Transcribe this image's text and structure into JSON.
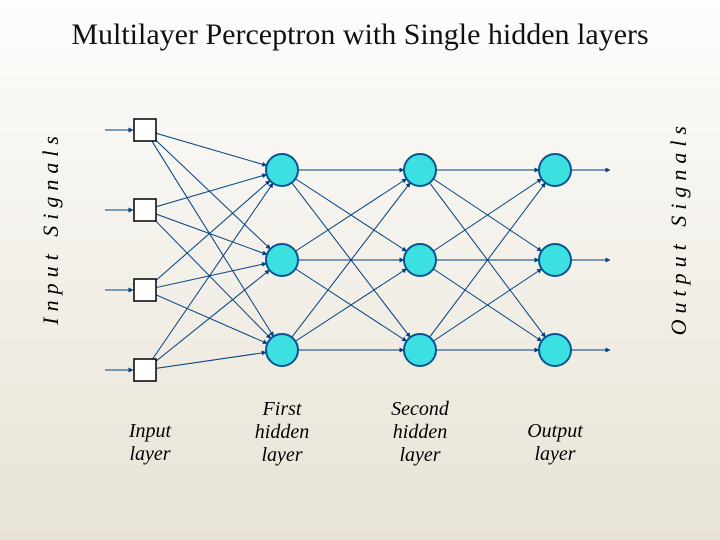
{
  "title": "Multilayer Perceptron with Single hidden layers",
  "side_labels": {
    "input": "Input Signals",
    "output": "Output Signals"
  },
  "layers": {
    "input": {
      "label_line1": "Input",
      "label_line2": "layer"
    },
    "hidden1": {
      "label_line1": "First",
      "label_line2": "hidden",
      "label_line3": "layer"
    },
    "hidden2": {
      "label_line1": "Second",
      "label_line2": "hidden",
      "label_line3": "layer"
    },
    "output": {
      "label_line1": "Output",
      "label_line2": "layer"
    }
  },
  "network": {
    "input_nodes": 4,
    "hidden1_nodes": 3,
    "hidden2_nodes": 3,
    "output_nodes": 3,
    "node_color": "#3de0e0",
    "node_stroke": "#0b5394",
    "input_node_shape": "square",
    "input_node_fill": "#ffffff",
    "input_node_stroke": "#000000",
    "connection_color": "#004080"
  }
}
